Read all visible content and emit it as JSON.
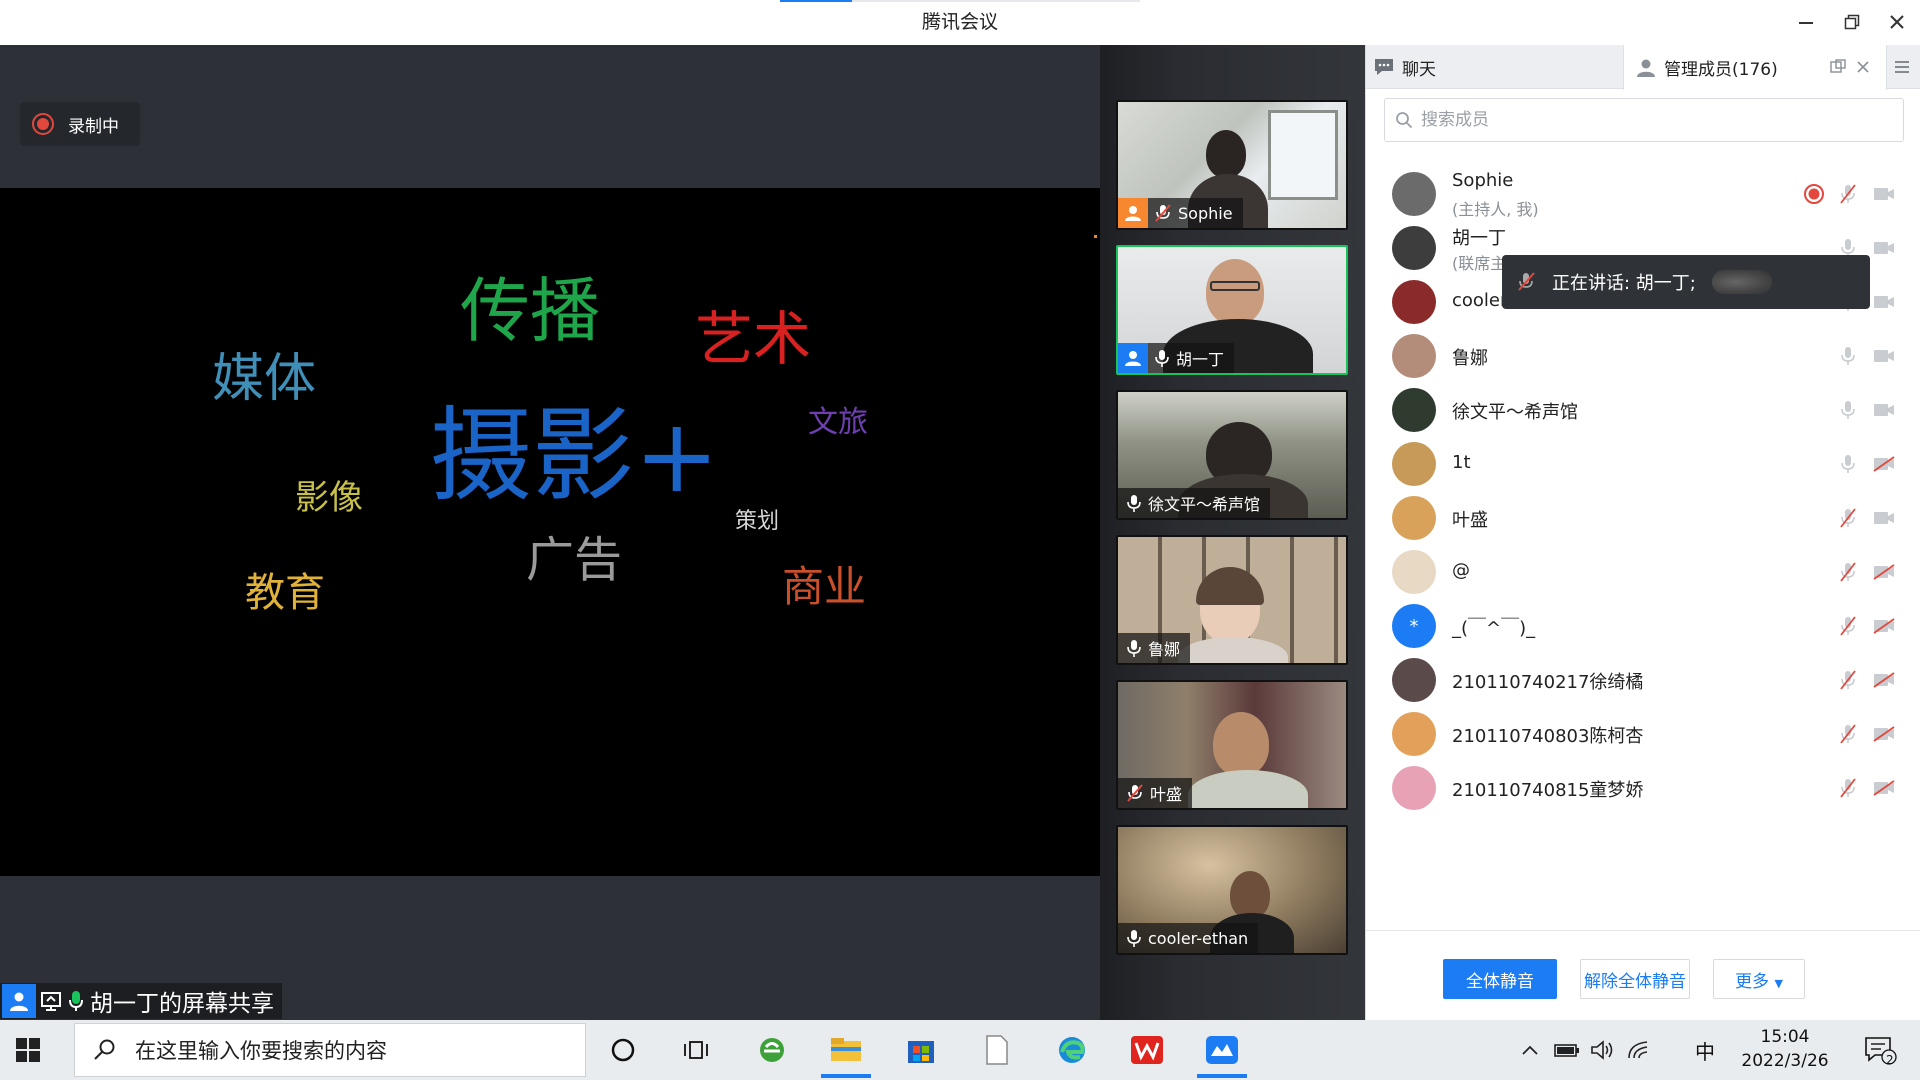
{
  "window": {
    "title": "腾讯会议",
    "upload_progress": 0.2
  },
  "stage": {
    "recording_label": "录制中",
    "share_label": "胡一丁的屏幕共享",
    "slide_words": [
      {
        "text": "传播",
        "color": "#1fa64b"
      },
      {
        "text": "艺术",
        "color": "#d92121"
      },
      {
        "text": "媒体",
        "color": "#3f8fb8"
      },
      {
        "text": "摄影+",
        "color": "#1a63c7"
      },
      {
        "text": "文旅",
        "color": "#6e3fb0"
      },
      {
        "text": "影像",
        "color": "#c9c04a"
      },
      {
        "text": "策划",
        "color": "#d6d6d6"
      },
      {
        "text": "广告",
        "color": "#9a9a9a"
      },
      {
        "text": "教育",
        "color": "#e0b23a"
      },
      {
        "text": "商业",
        "color": "#c9502a"
      }
    ]
  },
  "gallery": {
    "tiles": [
      {
        "name": "Sophie",
        "host": true,
        "host_color": "#f7882f",
        "muted": true,
        "active": false
      },
      {
        "name": "胡一丁",
        "host": true,
        "host_color": "#1b7cf4",
        "muted": false,
        "active": true
      },
      {
        "name": "徐文平～希声馆",
        "host": false,
        "muted": false,
        "active": false
      },
      {
        "name": "鲁娜",
        "host": false,
        "muted": false,
        "active": false
      },
      {
        "name": "叶盛",
        "host": false,
        "muted": true,
        "active": false
      },
      {
        "name": "cooler-ethan",
        "host": false,
        "muted": false,
        "active": false
      }
    ]
  },
  "panel": {
    "tab_chat": "聊天",
    "tab_members": "管理成员(176)",
    "search_placeholder": "搜索成员",
    "speaking_label": "正在讲话: 胡一丁;",
    "members": [
      {
        "name": "Sophie",
        "role": "(主持人, 我)",
        "recording": true,
        "mic_muted": true,
        "cam_off": false,
        "avatar_color": "#6b6b6b"
      },
      {
        "name": "胡一丁",
        "role": "(联席主持人)",
        "recording": false,
        "mic_muted": false,
        "cam_off": false,
        "avatar_color": "#3d3d3d"
      },
      {
        "name": "cooler-ethan",
        "role": "",
        "recording": false,
        "mic_muted": false,
        "cam_off": false,
        "avatar_color": "#8a2a2a"
      },
      {
        "name": "鲁娜",
        "role": "",
        "recording": false,
        "mic_muted": false,
        "cam_off": false,
        "avatar_color": "#b48c7a"
      },
      {
        "name": "徐文平～希声馆",
        "role": "",
        "recording": false,
        "mic_muted": false,
        "cam_off": false,
        "avatar_color": "#2e3b2e"
      },
      {
        "name": "1t",
        "role": "",
        "recording": false,
        "mic_muted": false,
        "cam_off": true,
        "avatar_color": "#c79a57"
      },
      {
        "name": "叶盛",
        "role": "",
        "recording": false,
        "mic_muted": true,
        "cam_off": false,
        "avatar_color": "#d9a25a"
      },
      {
        "name": "@",
        "role": "",
        "recording": false,
        "mic_muted": true,
        "cam_off": true,
        "avatar_color": "#e8d9c4"
      },
      {
        "name": "_(￣^￣)_",
        "role": "",
        "recording": false,
        "mic_muted": true,
        "cam_off": true,
        "avatar_color": "#1b7cf4"
      },
      {
        "name": "210110740217徐绮橘",
        "role": "",
        "recording": false,
        "mic_muted": true,
        "cam_off": true,
        "avatar_color": "#5a4a4a"
      },
      {
        "name": "210110740803陈柯杏",
        "role": "",
        "recording": false,
        "mic_muted": true,
        "cam_off": true,
        "avatar_color": "#e3a05a"
      },
      {
        "name": "210110740815童梦娇",
        "role": "",
        "recording": false,
        "mic_muted": true,
        "cam_off": true,
        "avatar_color": "#e7a2b6"
      }
    ],
    "btn_mute_all": "全体静音",
    "btn_unmute_all": "解除全体静音",
    "btn_more": "更多"
  },
  "taskbar": {
    "search_placeholder": "在这里输入你要搜索的内容",
    "ime": "中",
    "time": "15:04",
    "date": "2022/3/26",
    "notifications": "2"
  }
}
